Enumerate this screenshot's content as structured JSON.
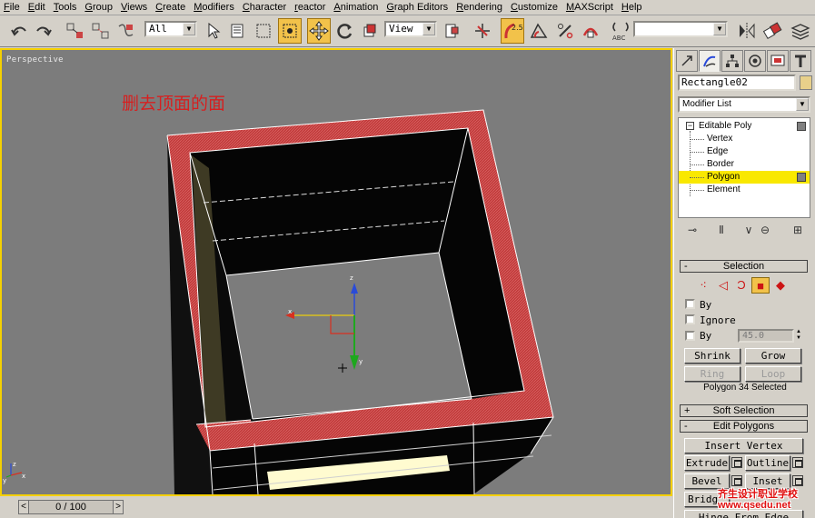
{
  "menu": [
    "File",
    "Edit",
    "Tools",
    "Group",
    "Views",
    "Create",
    "Modifiers",
    "Character",
    "reactor",
    "Animation",
    "Graph Editors",
    "Rendering",
    "Customize",
    "MAXScript",
    "Help"
  ],
  "toolbar": {
    "selection_filter": "All",
    "ref_coord": "View",
    "named_selection": "",
    "snap_label": "2.5",
    "abc_label": "ABC"
  },
  "viewport": {
    "label": "Perspective",
    "annotation": "删去顶面的面",
    "axis_x": "x",
    "axis_y": "y",
    "axis_z": "z"
  },
  "timebar": {
    "frame": "0 / 100",
    "prev": "<",
    "next": ">"
  },
  "panel": {
    "object_name": "Rectangle02",
    "modifier_list": "Modifier List",
    "stack": {
      "root": "Editable Poly",
      "items": [
        "Vertex",
        "Edge",
        "Border",
        "Polygon",
        "Element"
      ],
      "selected": "Polygon"
    },
    "selection": {
      "title": "Selection",
      "by_vertex": "By",
      "ignore": "Ignore",
      "by_angle": "By",
      "angle_value": "45.0",
      "shrink": "Shrink",
      "grow": "Grow",
      "ring": "Ring",
      "loop": "Loop",
      "status": "Polygon 34 Selected"
    },
    "soft_selection": {
      "title": "Soft Selection",
      "sign": "+"
    },
    "edit_polygons": {
      "title": "Edit Polygons",
      "sign": "-",
      "insert_vertex": "Insert Vertex",
      "extrude": "Extrude",
      "outline": "Outline",
      "bevel": "Bevel",
      "inset": "Inset",
      "bridge": "Bridg",
      "hinge": "Hinge From Edge"
    },
    "selection_sign": "-"
  },
  "watermark": {
    "line1": "齐生设计职业学校",
    "line2": "www.qsedu.net"
  },
  "colors": {
    "viewport_bg": "#7c7c7c",
    "active_border": "#f5d000",
    "selected_faces": "#c03030",
    "stack_highlight": "#f9e800",
    "annotation": "#d62020"
  }
}
